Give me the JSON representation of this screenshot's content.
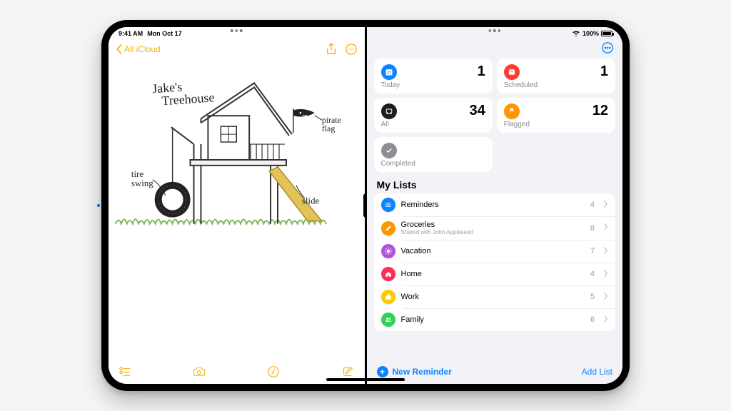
{
  "status": {
    "time": "9:41 AM",
    "date": "Mon Oct 17",
    "battery_pct": "100%"
  },
  "notes": {
    "back_label": "All iCloud",
    "meta_line": "",
    "drawing_title": "Jake's Treehouse",
    "label_tire_swing": "tire swing",
    "label_slide": "slide",
    "label_pirate_flag": "pirate flag",
    "colors": {
      "accent": "#f7b500",
      "slide": "#e4c257",
      "grass": "#7db85b",
      "flag": "#222"
    }
  },
  "reminders": {
    "smart": {
      "today": {
        "label": "Today",
        "count": "1",
        "color": "#0a84ff"
      },
      "scheduled": {
        "label": "Scheduled",
        "count": "1",
        "color": "#ff3b30"
      },
      "all": {
        "label": "All",
        "count": "34",
        "color": "#1c1c1e"
      },
      "flagged": {
        "label": "Flagged",
        "count": "12",
        "color": "#ff9500"
      },
      "completed": {
        "label": "Completed",
        "count": "",
        "color": "#8e8e93"
      }
    },
    "section_title": "My Lists",
    "lists": [
      {
        "name": "Reminders",
        "subtitle": "",
        "count": "4",
        "color": "#0a84ff",
        "icon": "list"
      },
      {
        "name": "Groceries",
        "subtitle": "Shared with John Appleseed",
        "count": "8",
        "color": "#ff9500",
        "icon": "pencil"
      },
      {
        "name": "Vacation",
        "subtitle": "",
        "count": "7",
        "color": "#af52de",
        "icon": "sun"
      },
      {
        "name": "Home",
        "subtitle": "",
        "count": "4",
        "color": "#ff2d55",
        "icon": "home"
      },
      {
        "name": "Work",
        "subtitle": "",
        "count": "5",
        "color": "#ffcc00",
        "icon": "briefcase"
      },
      {
        "name": "Family",
        "subtitle": "",
        "count": "6",
        "color": "#30d158",
        "icon": "people"
      }
    ],
    "new_reminder_label": "New Reminder",
    "add_list_label": "Add List",
    "accent": "#0a84ff"
  }
}
